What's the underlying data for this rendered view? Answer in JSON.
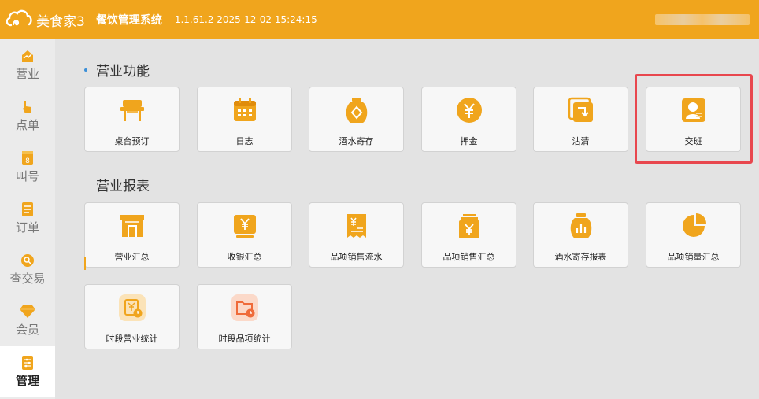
{
  "app": {
    "logo_text": "美食家3",
    "system_title": "餐饮管理系统",
    "version_time": "1.1.61.2 2025-12-02 15:24:15"
  },
  "sidebar": {
    "items": [
      {
        "label": "营业",
        "icon": "business-icon"
      },
      {
        "label": "点单",
        "icon": "order-hand-icon"
      },
      {
        "label": "叫号",
        "icon": "call-number-icon"
      },
      {
        "label": "订单",
        "icon": "order-list-icon"
      },
      {
        "label": "查交易",
        "icon": "search-transaction-icon"
      },
      {
        "label": "会员",
        "icon": "member-diamond-icon"
      },
      {
        "label": "管理",
        "icon": "manage-icon",
        "active": true
      }
    ]
  },
  "sections": {
    "business_functions": {
      "title": "营业功能",
      "cards": [
        {
          "label": "桌台预订",
          "icon": "table-reservation-icon"
        },
        {
          "label": "日志",
          "icon": "calendar-log-icon"
        },
        {
          "label": "酒水寄存",
          "icon": "wine-storage-icon"
        },
        {
          "label": "押金",
          "icon": "deposit-yen-icon"
        },
        {
          "label": "沽清",
          "icon": "sold-out-icon"
        },
        {
          "label": "交班",
          "icon": "shift-handover-icon"
        }
      ]
    },
    "business_reports": {
      "title": "营业报表",
      "cards": [
        {
          "label": "营业汇总",
          "icon": "store-summary-icon"
        },
        {
          "label": "收银汇总",
          "icon": "cashier-summary-icon"
        },
        {
          "label": "品项销售流水",
          "icon": "item-sales-flow-icon"
        },
        {
          "label": "品项销售汇总",
          "icon": "item-sales-summary-icon"
        },
        {
          "label": "酒水寄存报表",
          "icon": "wine-storage-report-icon"
        },
        {
          "label": "品项销量汇总",
          "icon": "item-volume-pie-icon"
        },
        {
          "label": "时段营业统计",
          "icon": "period-business-stats-icon"
        },
        {
          "label": "时段品项统计",
          "icon": "period-item-stats-icon"
        }
      ]
    }
  },
  "colors": {
    "brand": "#f0a51d",
    "highlight": "#e8474e",
    "background": "#e3e3e3"
  }
}
